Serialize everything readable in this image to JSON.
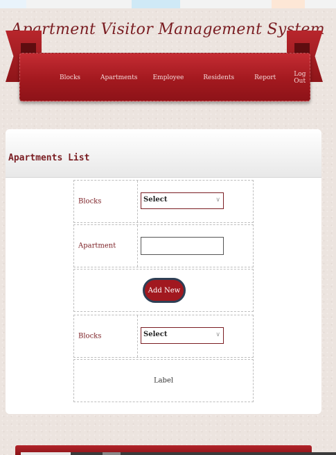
{
  "header": {
    "site_title": "Apartment Visitor Management System",
    "nav": [
      {
        "label": "Blocks"
      },
      {
        "label": "Apartments"
      },
      {
        "label": "Employee"
      },
      {
        "label": "Residents"
      },
      {
        "label": "Report"
      },
      {
        "label": "Log Out"
      }
    ]
  },
  "panel": {
    "title": "Apartments List",
    "form": {
      "blocks_label": "Blocks",
      "blocks_selected": "Select",
      "apartment_label": "Apartment",
      "apartment_value": "",
      "add_button": "Add New",
      "blocks2_label": "Blocks",
      "blocks2_selected": "Select",
      "status_label": "Label"
    }
  },
  "colors": {
    "accent": "#a3191f",
    "title_text": "#7a1d22",
    "button_border": "#2e3f55"
  }
}
